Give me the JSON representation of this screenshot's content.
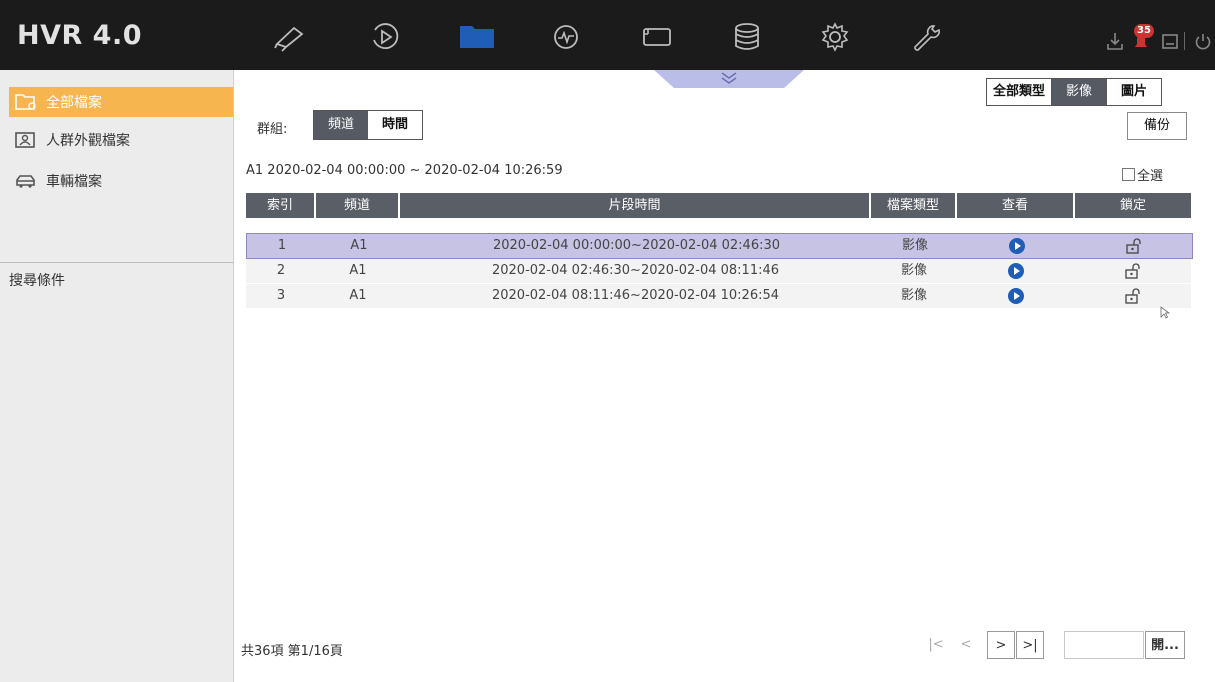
{
  "app": {
    "title": "HVR 4.0"
  },
  "toolbar": {
    "icons": [
      "live-view-camera-icon",
      "playback-icon",
      "file-management-icon",
      "smart-analysis-icon",
      "configuration-screen-icon",
      "storage-database-icon",
      "settings-gear-icon",
      "maintenance-wrench-icon"
    ],
    "active": "file-management-icon"
  },
  "status": {
    "alarm_count": "35"
  },
  "sidebar": {
    "items": [
      {
        "label": "全部檔案",
        "icon": "all-files-icon",
        "active": true
      },
      {
        "label": "人群外觀檔案",
        "icon": "human-appearance-file-icon",
        "active": false
      },
      {
        "label": "車輛檔案",
        "icon": "vehicle-file-icon",
        "active": false
      }
    ],
    "search_label": "搜尋條件"
  },
  "main": {
    "group_label": "群組:",
    "group_tabs": [
      {
        "label": "頻道",
        "active": true
      },
      {
        "label": "時間",
        "active": false
      }
    ],
    "type_tabs": [
      {
        "label": "全部類型",
        "active": false
      },
      {
        "label": "影像",
        "active": true
      },
      {
        "label": "圖片",
        "active": false
      }
    ],
    "backup_label": "備份",
    "range_text": "A1 2020-02-04 00:00:00 ~ 2020-02-04 10:26:59",
    "select_all_label": "全選",
    "table": {
      "headers": [
        "索引",
        "頻道",
        "片段時間",
        "檔案類型",
        "查看",
        "鎖定"
      ],
      "rows": [
        {
          "index": "1",
          "channel": "A1",
          "period": "2020-02-04 00:00:00~2020-02-04 02:46:30",
          "type": "影像",
          "selected": true
        },
        {
          "index": "2",
          "channel": "A1",
          "period": "2020-02-04 02:46:30~2020-02-04 08:11:46",
          "type": "影像",
          "selected": false
        },
        {
          "index": "3",
          "channel": "A1",
          "period": "2020-02-04 08:11:46~2020-02-04 10:26:54",
          "type": "影像",
          "selected": false
        }
      ]
    },
    "footer_text": "共36項 第1/16頁",
    "pager": {
      "first": "|<",
      "prev": "<",
      "next": ">",
      "last": ">|",
      "page_input_value": "",
      "go_label": "開..."
    }
  },
  "colors": {
    "accent": "#f6b54f",
    "topbar": "#1b1b1b",
    "active_nav": "#1f5db6",
    "header_bg": "#5a5f67",
    "selected_row": "#c6c3e5"
  }
}
